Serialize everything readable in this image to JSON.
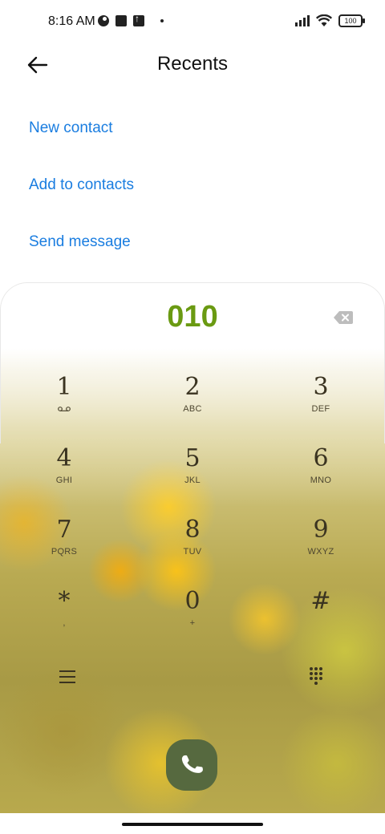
{
  "status_bar": {
    "time": "8:16 AM",
    "battery": "100",
    "icons": [
      "notification-circle-icon",
      "square-icon",
      "upload-icon",
      "dot-icon",
      "signal-icon",
      "wifi-icon",
      "battery-icon"
    ]
  },
  "header": {
    "title": "Recents",
    "back_icon": "arrow-left-icon"
  },
  "actions": [
    {
      "label": "New contact"
    },
    {
      "label": "Add to contacts"
    },
    {
      "label": "Send message"
    }
  ],
  "dialer": {
    "number": "010",
    "keys": [
      {
        "digit": "1",
        "letters": ""
      },
      {
        "digit": "2",
        "letters": "ABC"
      },
      {
        "digit": "3",
        "letters": "DEF"
      },
      {
        "digit": "4",
        "letters": "GHI"
      },
      {
        "digit": "5",
        "letters": "JKL"
      },
      {
        "digit": "6",
        "letters": "MNO"
      },
      {
        "digit": "7",
        "letters": "PQRS"
      },
      {
        "digit": "8",
        "letters": "TUV"
      },
      {
        "digit": "9",
        "letters": "WXYZ"
      },
      {
        "digit": "*",
        "letters": ","
      },
      {
        "digit": "0",
        "letters": "+"
      },
      {
        "digit": "#",
        "letters": ""
      }
    ]
  },
  "colors": {
    "accent_link": "#1a7de0",
    "number": "#6a9a12",
    "call_button": "#56693f"
  }
}
